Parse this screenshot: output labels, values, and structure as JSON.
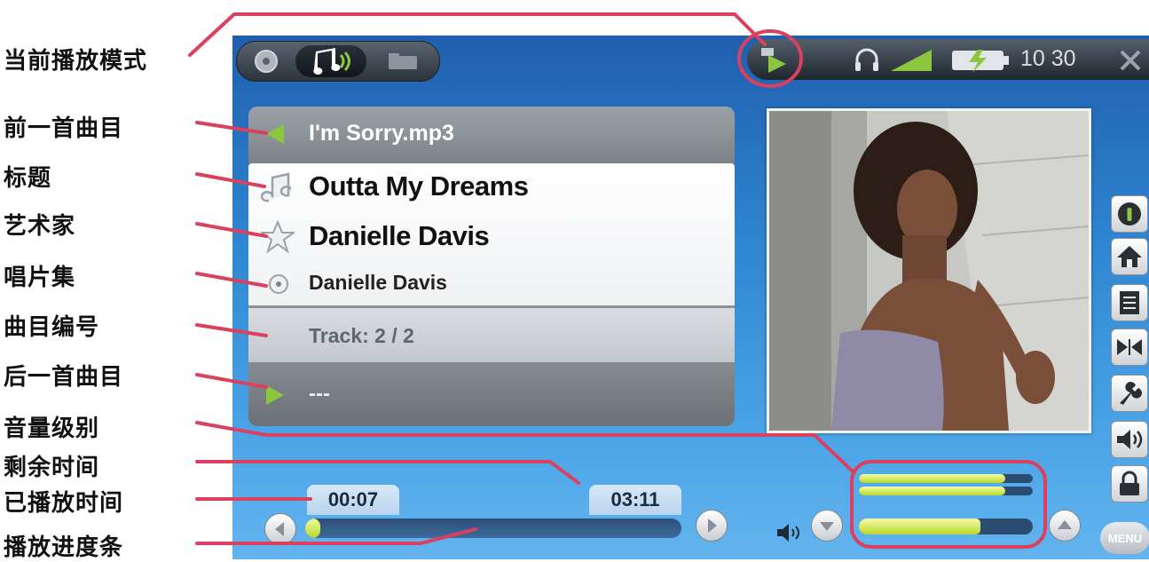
{
  "annotations": {
    "play_mode": "当前播放模式",
    "prev_track": "前一首曲目",
    "title": "标题",
    "artist": "艺术家",
    "album": "唱片集",
    "track_number": "曲目编号",
    "next_track": "后一首曲目",
    "volume_level": "音量级别",
    "remaining_time": "剩余时间",
    "elapsed_time": "已播放时间",
    "progress_bar": "播放进度条"
  },
  "status": {
    "clock": "10 30"
  },
  "player": {
    "prev_file": "I'm Sorry.mp3",
    "title": "Outta My Dreams",
    "artist": "Danielle Davis",
    "album": "Danielle Davis",
    "track": "Track: 2 / 2",
    "next_file": "---",
    "elapsed": "00:07",
    "remaining": "03:11",
    "progress_fraction": 0.04,
    "volume_fraction": 0.7,
    "menu_label": "MENU"
  },
  "colors": {
    "accent_green": "#8cc63f",
    "callout_red": "#d9415e",
    "screen_blue": "#2f86d1"
  },
  "icons": [
    "music-note-icon",
    "headphones-icon",
    "signal-icon",
    "battery-icon",
    "close-icon",
    "info-icon",
    "home-icon",
    "playlist-icon",
    "repeat-icon",
    "settings-icon",
    "volume-icon",
    "lock-icon"
  ]
}
